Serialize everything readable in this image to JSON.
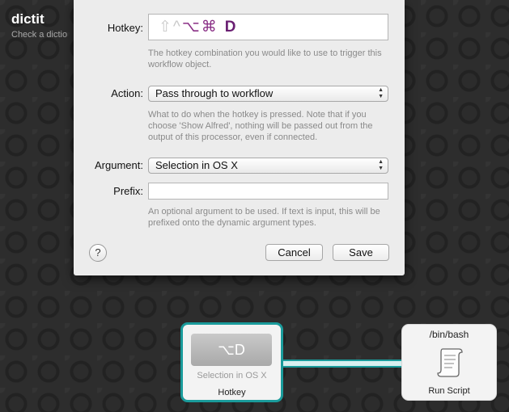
{
  "workflow": {
    "title": "dictit",
    "subtitle": "Check a dictio"
  },
  "sheet": {
    "hotkey": {
      "label": "Hotkey:",
      "modifiers": "⇧^",
      "alt": "⌥⌘",
      "key": "D",
      "help": "The hotkey combination you would like to use to trigger this workflow object."
    },
    "action": {
      "label": "Action:",
      "selected": "Pass through to workflow",
      "help": "What to do when the hotkey is pressed. Note that if you choose 'Show Alfred', nothing will be passed out from the output of this processor, even if connected."
    },
    "argument": {
      "label": "Argument:",
      "selected": "Selection in OS X"
    },
    "prefix": {
      "label": "Prefix:",
      "value": "",
      "help": "An optional argument to be used. If text is input, this will be prefixed onto the dynamic argument types."
    },
    "buttons": {
      "help": "?",
      "cancel": "Cancel",
      "save": "Save"
    }
  },
  "nodes": {
    "hotkey": {
      "badge": "⌥D",
      "subtitle": "Selection in OS X",
      "name": "Hotkey"
    },
    "script": {
      "title": "/bin/bash",
      "name": "Run Script",
      "icon": "scroll-icon"
    }
  },
  "colors": {
    "accent": "#1a9b9b",
    "hotkey_key": "#6a1f72"
  }
}
